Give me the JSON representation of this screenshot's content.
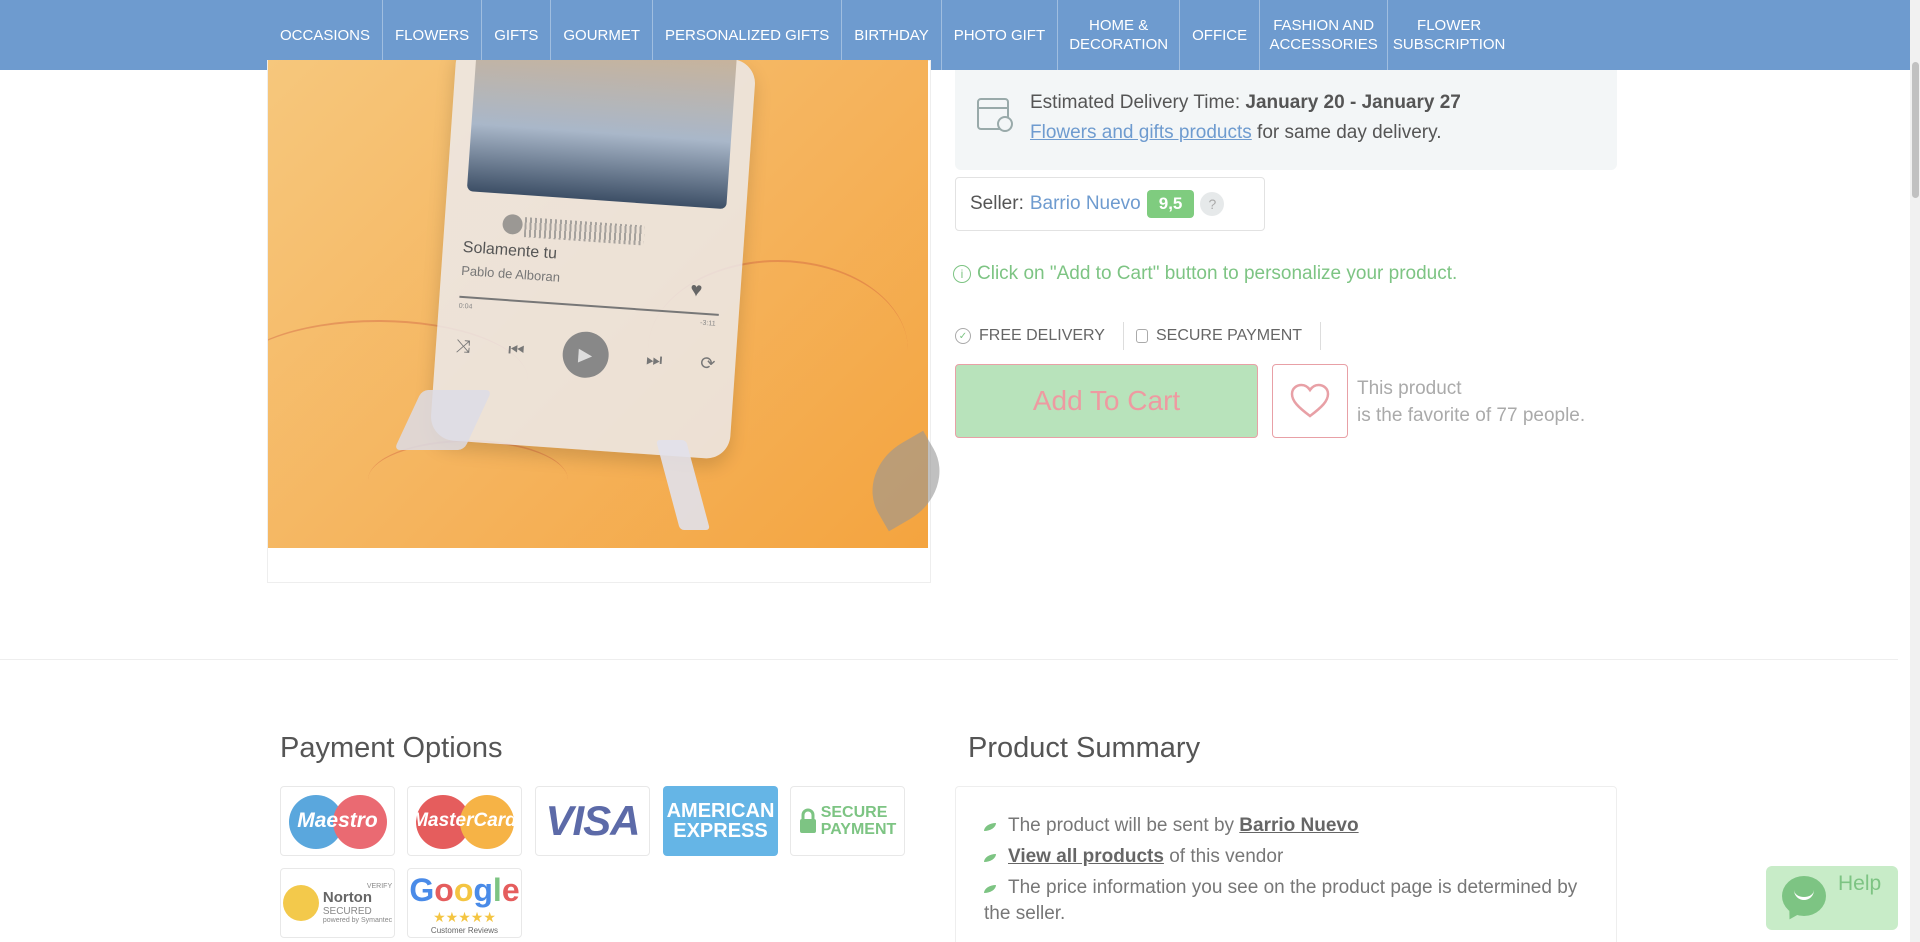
{
  "nav": {
    "items": [
      {
        "label": "OCCASIONS"
      },
      {
        "label": "FLOWERS"
      },
      {
        "label": "GIFTS"
      },
      {
        "label": "GOURMET"
      },
      {
        "label": "PERSONALIZED GIFTS"
      },
      {
        "label": "BIRTHDAY"
      },
      {
        "label": "PHOTO GIFT"
      },
      {
        "label": "HOME & DECORATION"
      },
      {
        "label": "OFFICE"
      },
      {
        "label": "FASHION AND ACCESSORIES"
      },
      {
        "label": "FLOWER SUBSCRIPTION"
      }
    ]
  },
  "product_image": {
    "song_title": "Solamente tu",
    "song_artist": "Pablo de Alboran",
    "time_start": "0:04",
    "time_end": "-3:11"
  },
  "delivery": {
    "label": "Estimated Delivery Time:",
    "dates": "January 20 - January 27",
    "link_text": "Flowers and gifts products",
    "suffix": "for same day delivery."
  },
  "seller": {
    "label": "Seller:",
    "name": "Barrio Nuevo",
    "score": "9,5",
    "help": "?"
  },
  "info_note": "Click on \"Add to Cart\" button to personalize your product.",
  "badges": {
    "free_delivery": "FREE DELIVERY",
    "secure_payment": "SECURE PAYMENT"
  },
  "cart": {
    "add_label": "Add To Cart",
    "fav_line1": "This product",
    "fav_line2": "is the favorite of 77 people."
  },
  "payment": {
    "title": "Payment Options",
    "maestro": "Maestro",
    "mastercard": "MasterCard",
    "visa": "VISA",
    "amex_line1": "AMERICAN",
    "amex_line2": "EXPRESS",
    "secure_line1": "SECURE",
    "secure_line2": "PAYMENT",
    "norton_verify": "VERIFY",
    "norton_name": "Norton",
    "norton_secured": "SECURED",
    "norton_by": "powered by Symantec",
    "google": "Google",
    "google_stars": "★★★★★",
    "google_reviews": "Customer Reviews"
  },
  "summary": {
    "title": "Product Summary",
    "item1_prefix": "The product will be sent by",
    "item1_link": "Barrio Nuevo",
    "item2_link": "View all products",
    "item2_suffix": "of this vendor",
    "item3": "The price information you see on the product page is determined by the seller."
  },
  "help": {
    "label": "Help"
  },
  "colors": {
    "nav_bg": "#6e9bcf",
    "accent_green": "#7dc483",
    "link_blue": "#6e9bcf",
    "cart_bg": "#b8e3bb",
    "cart_border": "#e8a0a6"
  }
}
